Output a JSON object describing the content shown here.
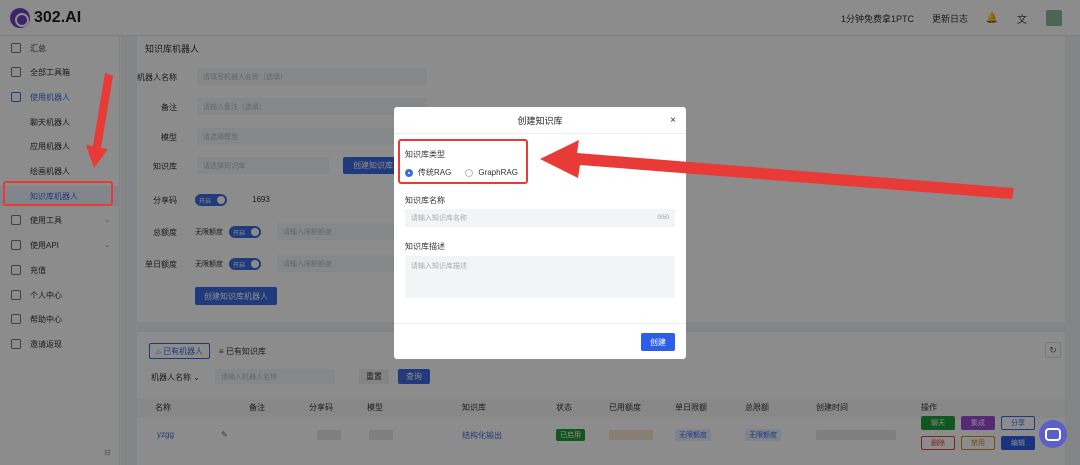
{
  "topbar": {
    "logo_text": "302.AI",
    "items": [
      "1分钟免费拿1PTC",
      "更新日志"
    ]
  },
  "sidebar": {
    "items": [
      {
        "label": "汇总",
        "icon": "dashboard-icon"
      },
      {
        "label": "全部工具箱",
        "icon": "toolbox-icon"
      },
      {
        "label": "使用机器人",
        "icon": "robot-icon"
      },
      {
        "label": "使用工具",
        "icon": "tools-icon"
      },
      {
        "label": "使用API",
        "icon": "api-icon"
      },
      {
        "label": "充值",
        "icon": "recharge-icon"
      },
      {
        "label": "个人中心",
        "icon": "user-icon"
      },
      {
        "label": "帮助中心",
        "icon": "help-icon"
      },
      {
        "label": "邀请返现",
        "icon": "invite-icon"
      }
    ],
    "subitems": [
      "聊天机器人",
      "应用机器人",
      "绘画机器人",
      "知识库机器人"
    ]
  },
  "form": {
    "title": "知识库机器人",
    "name_label": "机器人名称",
    "name_placeholder": "请填写机器人名称（选填）",
    "note_label": "备注",
    "note_placeholder": "请输入备注（选填）",
    "model_label": "模型",
    "model_placeholder": "请选择模型",
    "kb_label": "知识库",
    "kb_placeholder": "请选择知识库",
    "create_kb_btn": "创建知识库",
    "share_label": "分享码",
    "toggle_on": "开启",
    "share_code": "1693",
    "total_label": "总额度",
    "unlimited": "无限额度",
    "total_placeholder": "请输入限额额度",
    "daily_label": "单日额度",
    "create_bot_btn": "创建知识库机器人"
  },
  "list": {
    "tab_bots": "已有机器人",
    "tab_kb": "已有知识库",
    "filter_label": "机器人名称",
    "filter_placeholder": "请输入机器人名称",
    "reset": "重置",
    "query": "查询",
    "columns": [
      "名称",
      "备注",
      "分享码",
      "模型",
      "知识库",
      "状态",
      "已用额度",
      "单日限额",
      "总限额",
      "创建时间",
      "操作"
    ],
    "row": {
      "name": "yzgg",
      "kb": "结构化输出",
      "status": "已启用",
      "daily": "无限额度",
      "total": "无限额度",
      "ops": [
        "聊天",
        "集成",
        "分享",
        "删除",
        "禁用",
        "编辑"
      ]
    }
  },
  "modal": {
    "title": "创建知识库",
    "type_label": "知识库类型",
    "type_options": [
      "传统RAG",
      "GraphRAG"
    ],
    "selected_type": "传统RAG",
    "name_label": "知识库名称",
    "name_placeholder": "请输入知识库名称",
    "name_count": "0/50",
    "desc_label": "知识库描述",
    "desc_placeholder": "请输入知识库描述",
    "create_btn": "创建"
  },
  "colors": {
    "primary": "#3d6be0",
    "annotation": "#e83a36",
    "brand": "#6f42c1"
  }
}
